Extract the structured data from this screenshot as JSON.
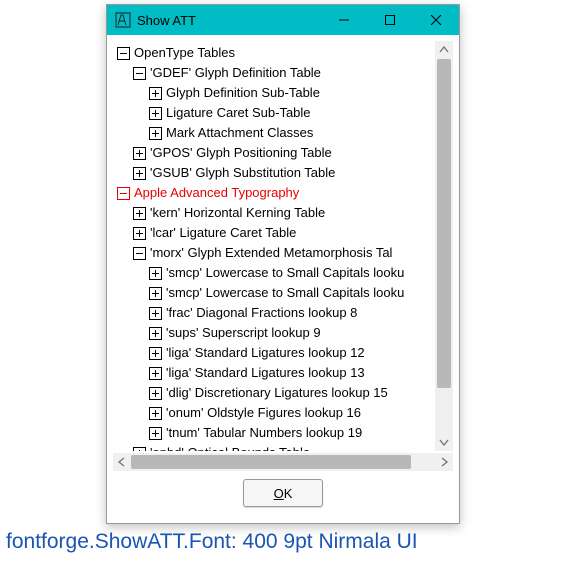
{
  "window": {
    "title": "Show ATT"
  },
  "tree": [
    {
      "depth": 0,
      "box": "minus",
      "label": "OpenType Tables",
      "hl": false
    },
    {
      "depth": 1,
      "box": "minus",
      "label": "'GDEF' Glyph Definition Table",
      "hl": false
    },
    {
      "depth": 2,
      "box": "plus",
      "label": "Glyph Definition Sub-Table",
      "hl": false
    },
    {
      "depth": 2,
      "box": "plus",
      "label": "Ligature Caret Sub-Table",
      "hl": false
    },
    {
      "depth": 2,
      "box": "plus",
      "label": "Mark Attachment Classes",
      "hl": false
    },
    {
      "depth": 1,
      "box": "plus",
      "label": "'GPOS' Glyph Positioning Table",
      "hl": false
    },
    {
      "depth": 1,
      "box": "plus",
      "label": "'GSUB' Glyph Substitution Table",
      "hl": false
    },
    {
      "depth": 0,
      "box": "minus",
      "label": "Apple Advanced Typography",
      "hl": true
    },
    {
      "depth": 1,
      "box": "plus",
      "label": "'kern' Horizontal Kerning Table",
      "hl": false
    },
    {
      "depth": 1,
      "box": "plus",
      "label": "'lcar' Ligature Caret Table",
      "hl": false
    },
    {
      "depth": 1,
      "box": "minus",
      "label": "'morx' Glyph Extended Metamorphosis Tal",
      "hl": false
    },
    {
      "depth": 2,
      "box": "plus",
      "label": "'smcp' Lowercase to Small Capitals looku",
      "hl": false
    },
    {
      "depth": 2,
      "box": "plus",
      "label": "'smcp' Lowercase to Small Capitals looku",
      "hl": false
    },
    {
      "depth": 2,
      "box": "plus",
      "label": "'frac' Diagonal Fractions lookup 8",
      "hl": false
    },
    {
      "depth": 2,
      "box": "plus",
      "label": "'sups' Superscript lookup 9",
      "hl": false
    },
    {
      "depth": 2,
      "box": "plus",
      "label": "'liga' Standard Ligatures lookup 12",
      "hl": false
    },
    {
      "depth": 2,
      "box": "plus",
      "label": "'liga' Standard Ligatures lookup 13",
      "hl": false
    },
    {
      "depth": 2,
      "box": "plus",
      "label": "'dlig' Discretionary Ligatures lookup 15",
      "hl": false
    },
    {
      "depth": 2,
      "box": "plus",
      "label": "'onum' Oldstyle Figures lookup 16",
      "hl": false
    },
    {
      "depth": 2,
      "box": "plus",
      "label": "'tnum' Tabular Numbers lookup 19",
      "hl": false
    },
    {
      "depth": 1,
      "box": "plus",
      "label": "'opbd' Optical Bounds Table",
      "hl": false
    }
  ],
  "buttons": {
    "ok_prefix": "O",
    "ok_rest": "K"
  },
  "caption": "fontforge.ShowATT.Font: 400 9pt Nirmala UI"
}
